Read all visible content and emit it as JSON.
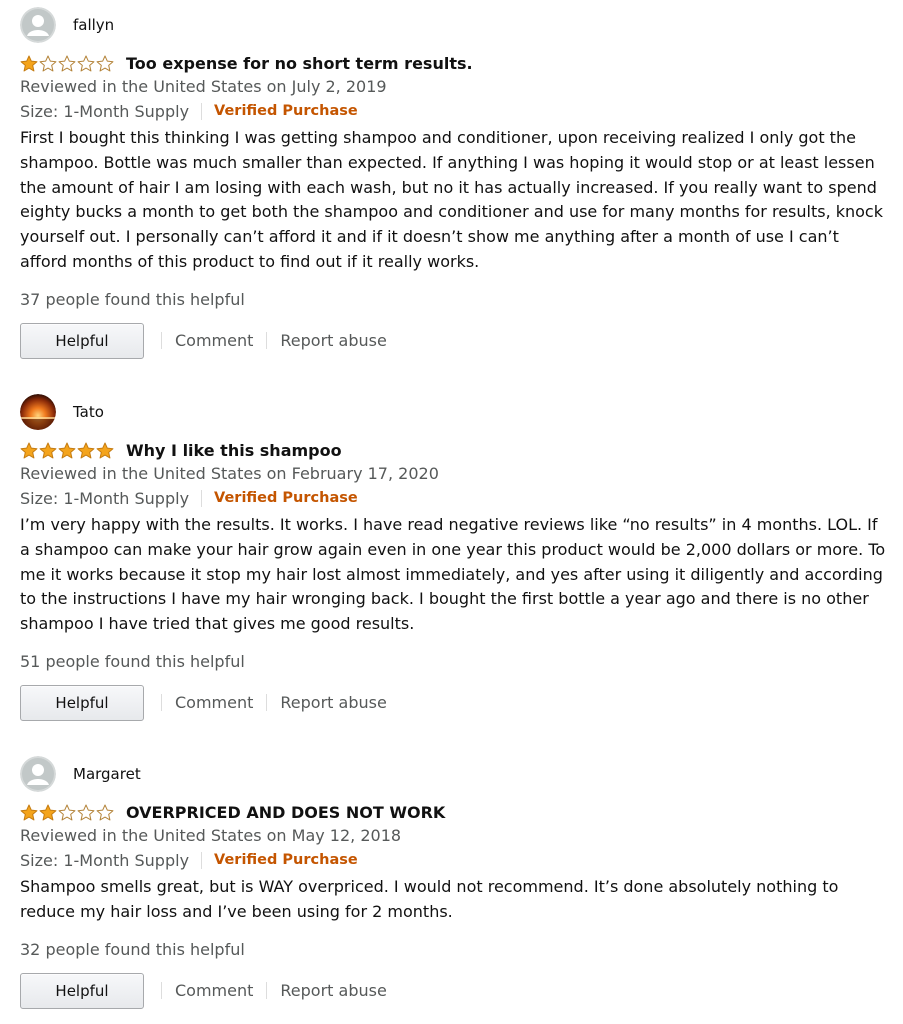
{
  "reviews": [
    {
      "name": "fallyn",
      "avatar": "default-avatar-icon",
      "rating": 1,
      "title": "Too expense for no short term results.",
      "reviewed": "Reviewed in the United States on July 2, 2019",
      "size": "Size: 1-Month Supply",
      "verified": "Verified Purchase",
      "body": "First I bought this thinking I was getting shampoo and conditioner, upon receiving realized I only got the shampoo. Bottle was much smaller than expected. If anything I was hoping it would stop or at least lessen the amount of hair I am losing with each wash, but no it has actually increased. If you really want to spend eighty bucks a month to get both the shampoo and conditioner and use for many months for results, knock yourself out. I personally can’t afford it and if it doesn’t show me anything after a month of use I can’t afford months of this product to find out if it really works.",
      "helpful_count": "37 people found this helpful",
      "helpful_label": "Helpful",
      "comment_label": "Comment",
      "report_label": "Report abuse"
    },
    {
      "name": "Tato",
      "avatar": "sunset-photo-avatar",
      "rating": 5,
      "title": "Why I like this shampoo",
      "reviewed": "Reviewed in the United States on February 17, 2020",
      "size": "Size: 1-Month Supply",
      "verified": "Verified Purchase",
      "body": "I’m very happy with the results. It works. I have read negative reviews like “no results” in 4 months. LOL. If a shampoo can make your hair grow again even in one year this product would be 2,000 dollars or more. To me it works because it stop my hair lost almost immediately, and yes after using it diligently and according to the instructions I have my hair wronging back. I bought the first bottle a year ago and there is no other shampoo I have tried that gives me good results.",
      "helpful_count": "51 people found this helpful",
      "helpful_label": "Helpful",
      "comment_label": "Comment",
      "report_label": "Report abuse"
    },
    {
      "name": "Margaret",
      "avatar": "default-avatar-icon",
      "rating": 2,
      "title": "OVERPRICED AND DOES NOT WORK",
      "reviewed": "Reviewed in the United States on May 12, 2018",
      "size": "Size: 1-Month Supply",
      "verified": "Verified Purchase",
      "body": "Shampoo smells great, but is WAY overpriced. I would not recommend. It’s done absolutely nothing to reduce my hair loss and I’ve been using for 2 months.",
      "helpful_count": "32 people found this helpful",
      "helpful_label": "Helpful",
      "comment_label": "Comment",
      "report_label": "Report abuse"
    }
  ],
  "colors": {
    "star_fill": "#f4a41c",
    "star_stroke": "#c57c12",
    "verified": "#c45500",
    "meta": "#565959"
  }
}
